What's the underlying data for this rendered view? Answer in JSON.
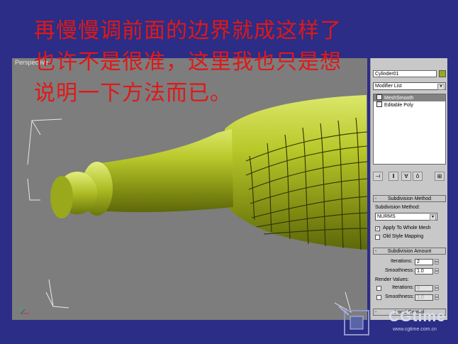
{
  "caption": {
    "lines": [
      "再慢慢调前面的边界就成这样了",
      "也许不是很准，这里我也只是想",
      "说明一下方法而已。"
    ]
  },
  "viewport": {
    "label": "Perspective"
  },
  "command_panel": {
    "object_name": "Cylinder01",
    "modifier_list_label": "Modifier List",
    "stack": [
      {
        "label": "MeshSmooth",
        "selected": true
      },
      {
        "label": "Editable Poly",
        "selected": false
      }
    ],
    "subdivision_method": {
      "header": "Subdivision Method",
      "method_label": "Subdivision Method:",
      "method_value": "NURMS",
      "apply_whole_mesh_label": "Apply To Whole Mesh",
      "apply_whole_mesh_checked": true,
      "old_style_label": "Old Style Mapping",
      "old_style_checked": false
    },
    "subdivision_amount": {
      "header": "Subdivision Amount",
      "iterations_label": "Iterations:",
      "iterations_value": "2",
      "smoothness_label": "Smoothness:",
      "smoothness_value": "1.0",
      "render_values_label": "Render Values:",
      "render_iterations_label": "Iterations:",
      "render_iterations_value": "0",
      "render_smoothness_label": "Smoothness:",
      "render_smoothness_value": "1.0"
    },
    "local_control": {
      "header": "Local Control"
    }
  },
  "watermark": {
    "brand": "CGtime",
    "url": "www.cgtime.com.cn"
  },
  "colors": {
    "background": "#2b2d86",
    "caption": "#e01818",
    "model": "#b6c42a",
    "viewport": "#7d7d7d"
  }
}
